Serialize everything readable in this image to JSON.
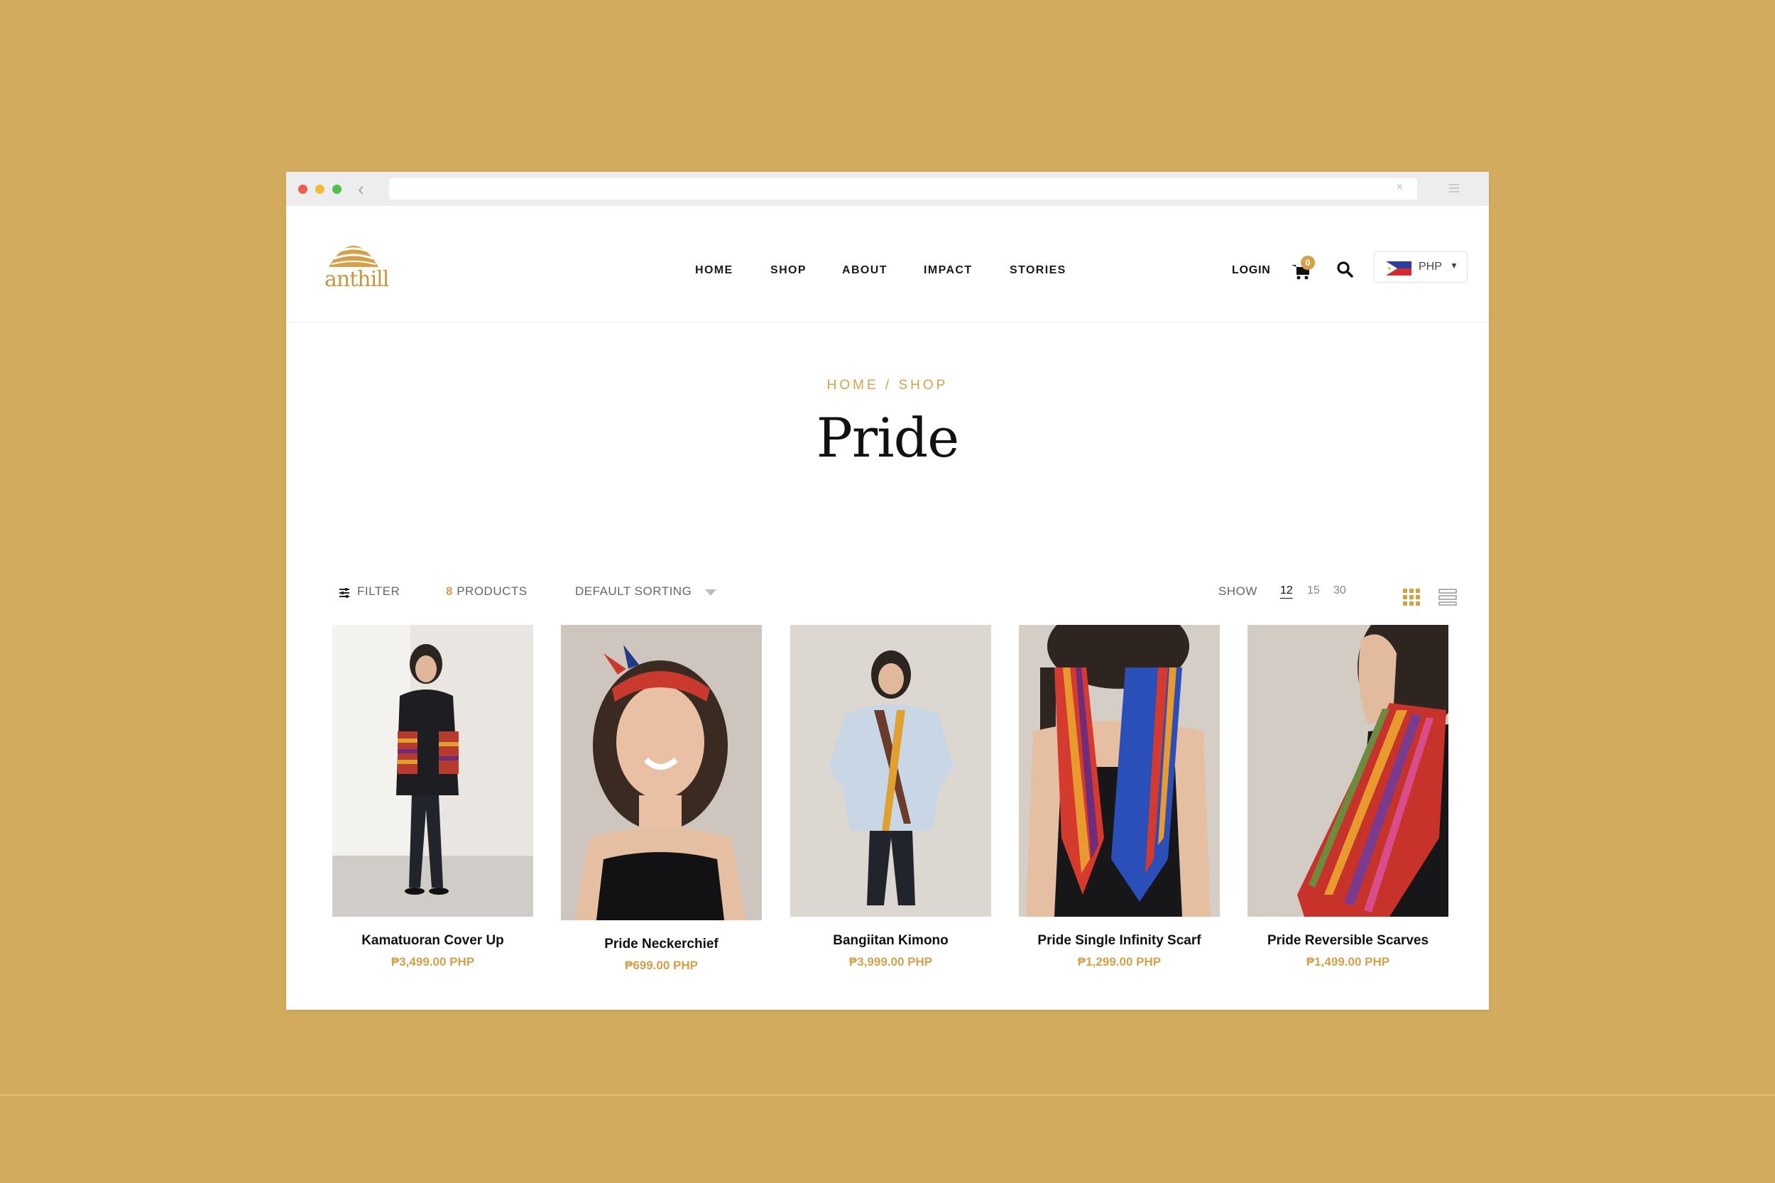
{
  "browser": {
    "back_glyph": "‹",
    "close_glyph": "×"
  },
  "header": {
    "logo_text": "anthill",
    "nav": [
      "HOME",
      "SHOP",
      "ABOUT",
      "IMPACT",
      "STORIES"
    ],
    "login_label": "LOGIN",
    "cart_count": "0",
    "currency": "PHP"
  },
  "page": {
    "breadcrumb": "HOME / SHOP",
    "title": "Pride"
  },
  "toolbar": {
    "filter_label": "FILTER",
    "products_count": "8",
    "products_label": "PRODUCTS",
    "sorting_label": "DEFAULT SORTING",
    "show_label": "SHOW",
    "show_options": [
      "12",
      "15",
      "30"
    ],
    "show_active": "12"
  },
  "products": [
    {
      "name": "Kamatuoran Cover Up",
      "price": "₱3,499.00 PHP"
    },
    {
      "name": "Pride Neckerchief",
      "price": "₱699.00 PHP"
    },
    {
      "name": "Bangiitan Kimono",
      "price": "₱3,999.00 PHP"
    },
    {
      "name": "Pride Single Infinity Scarf",
      "price": "₱1,299.00 PHP"
    },
    {
      "name": "Pride Reversible Scarves",
      "price": "₱1,499.00 PHP"
    }
  ],
  "colors": {
    "background": "#D3AB5E",
    "accent": "#D4A04A"
  }
}
